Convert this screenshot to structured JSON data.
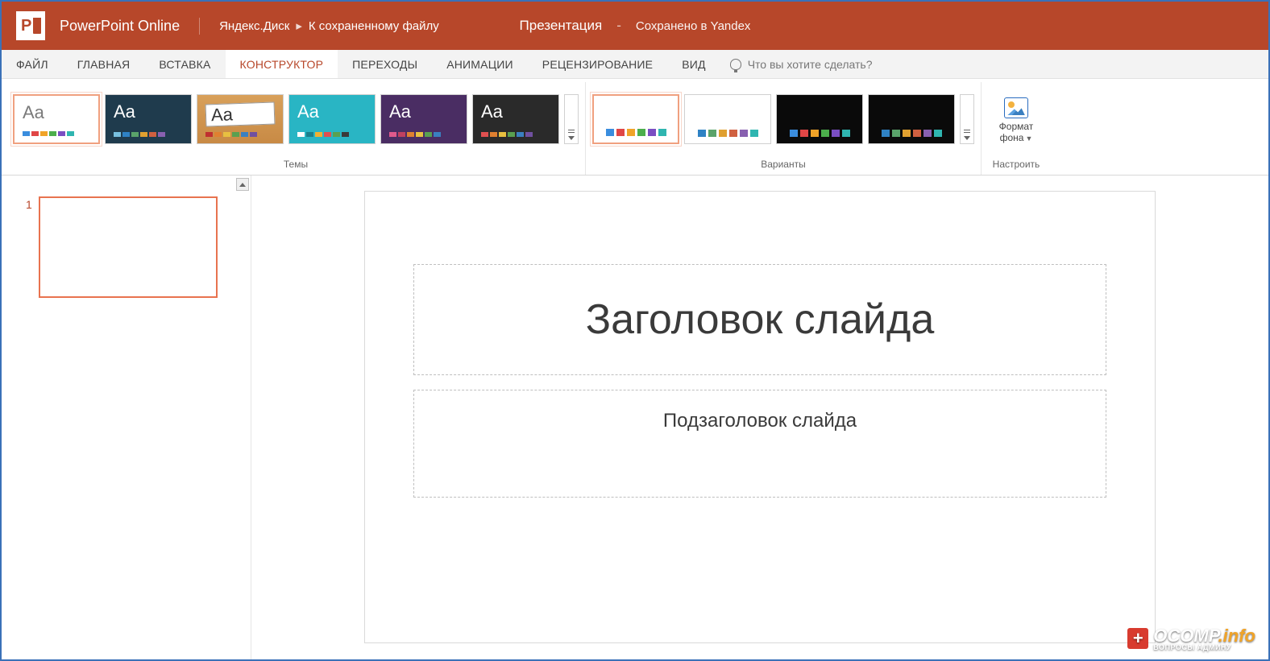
{
  "app": {
    "name": "PowerPoint Online"
  },
  "breadcrumb": {
    "location": "Яндекс.Диск",
    "file": "К сохраненному файлу"
  },
  "document": {
    "name": "Презентация",
    "save_status": "Сохранено в Yandex"
  },
  "tabs": {
    "file": "ФАЙЛ",
    "home": "ГЛАВНАЯ",
    "insert": "ВСТАВКА",
    "design": "КОНСТРУКТОР",
    "transitions": "ПЕРЕХОДЫ",
    "animations": "АНИМАЦИИ",
    "review": "РЕЦЕНЗИРОВАНИЕ",
    "view": "ВИД"
  },
  "tellme": {
    "placeholder": "Что вы хотите сделать?"
  },
  "ribbon": {
    "themes_label": "Темы",
    "variants_label": "Варианты",
    "customize_label": "Настроить",
    "bg_format": "Формат фона"
  },
  "themes": [
    {
      "bg": "#ffffff",
      "fg": "#7a7a7a",
      "colors": [
        "#3a8dde",
        "#e04646",
        "#f0a328",
        "#4cae4c",
        "#7a4ec2",
        "#2fb5b0"
      ]
    },
    {
      "bg": "#1f3b4d",
      "fg": "#ffffff",
      "colors": [
        "#78c0e0",
        "#2f82c4",
        "#5aa36a",
        "#e0a030",
        "#d06040",
        "#8860b0"
      ]
    },
    {
      "bg": "wood",
      "fg": "#333333",
      "colors": [
        "#c03030",
        "#e08030",
        "#e8c040",
        "#5aa050",
        "#3a80c0",
        "#7050a0"
      ]
    },
    {
      "bg": "#29b5c4",
      "fg": "#ffffff",
      "colors": [
        "#ffffff",
        "#1a7f8c",
        "#f0b030",
        "#e05050",
        "#5aa050",
        "#3a3a3a"
      ]
    },
    {
      "bg": "#4a2d63",
      "fg": "#ffffff",
      "colors": [
        "#e05a8c",
        "#c04060",
        "#e08030",
        "#e8c040",
        "#5aa050",
        "#3a80c0"
      ]
    },
    {
      "bg": "#2a2a2a",
      "fg": "#ffffff",
      "colors": [
        "#e05050",
        "#e08030",
        "#e8c040",
        "#5aa050",
        "#3a80c0",
        "#7050a0"
      ]
    }
  ],
  "variants": [
    {
      "bg": "#ffffff",
      "colors": [
        "#3a8dde",
        "#e04646",
        "#f0a328",
        "#4cae4c",
        "#7a4ec2",
        "#2fb5b0"
      ]
    },
    {
      "bg": "#ffffff",
      "colors": [
        "#2f82c4",
        "#5aa36a",
        "#e0a030",
        "#d06040",
        "#8860b0",
        "#2fb5b0"
      ]
    },
    {
      "bg": "#0a0a0a",
      "colors": [
        "#3a8dde",
        "#e04646",
        "#f0a328",
        "#4cae4c",
        "#7a4ec2",
        "#2fb5b0"
      ]
    },
    {
      "bg": "#0a0a0a",
      "colors": [
        "#2f82c4",
        "#5aa36a",
        "#e0a030",
        "#d06040",
        "#8860b0",
        "#2fb5b0"
      ]
    }
  ],
  "slide": {
    "number": "1",
    "title_ph": "Заголовок слайда",
    "subtitle_ph": "Подзаголовок слайда"
  },
  "watermark": {
    "brand": "OCOMP",
    "tld": ".info",
    "tagline": "ВОПРОСЫ АДМИНУ"
  }
}
